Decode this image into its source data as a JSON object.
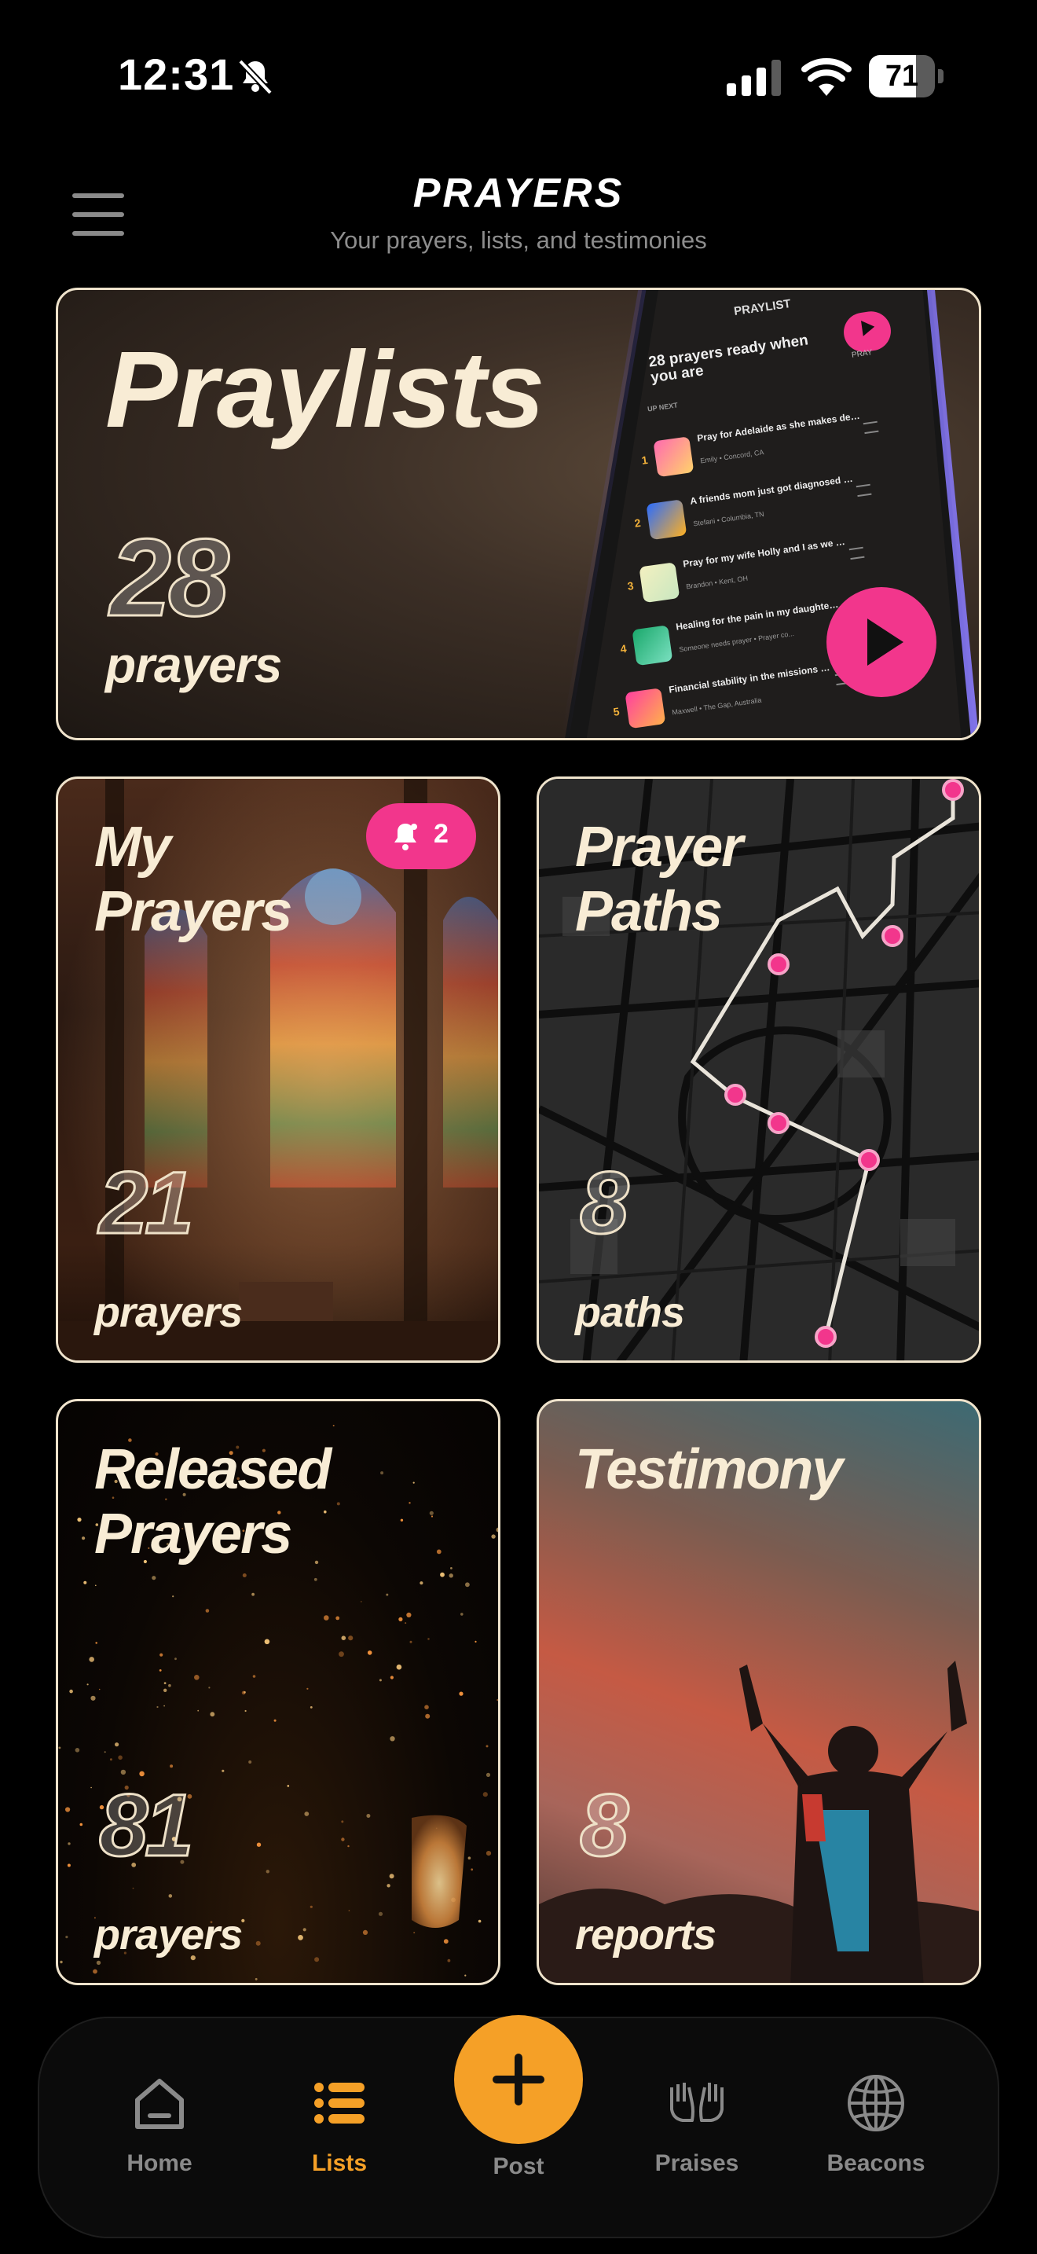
{
  "status_bar": {
    "time": "12:31",
    "battery": 71,
    "battery_text": "71"
  },
  "header": {
    "title": "PRAYERS",
    "subtitle": "Your prayers, lists, and testimonies"
  },
  "cards": {
    "praylists": {
      "title": "Praylists",
      "count": "28",
      "unit": "prayers",
      "phone": {
        "header": "PRAYLIST",
        "pray_label": "PRAY",
        "headline": "28 prayers ready when you are",
        "up_next": "UP NEXT",
        "items": [
          {
            "n": "1",
            "text": "Pray for Adelaide as she makes decisions about her future; col...",
            "sub": "Emily • Concord, CA"
          },
          {
            "n": "2",
            "text": "A friends mom just got diagnosed with late stage lung...",
            "sub": "Stefani • Columbia, TN"
          },
          {
            "n": "3",
            "text": "Pray for my wife Holly and I as we consider being a part of th...",
            "sub": "Brandon • Kent, OH"
          },
          {
            "n": "4",
            "text": "Healing for the pain in my daughter's back",
            "sub": "Someone needs prayer • Prayer co..."
          },
          {
            "n": "5",
            "text": "Financial stability in the missions field",
            "sub": "Maxwell • The Gap, Australia"
          }
        ]
      }
    },
    "my_prayers": {
      "title_line1": "My",
      "title_line2": "Prayers",
      "count": "21",
      "unit": "prayers",
      "badge_count": "2"
    },
    "prayer_paths": {
      "title_line1": "Prayer",
      "title_line2": "Paths",
      "count": "8",
      "unit": "paths"
    },
    "released": {
      "title_line1": "Released",
      "title_line2": "Prayers",
      "count": "81",
      "unit": "prayers"
    },
    "testimony": {
      "title": "Testimony",
      "count": "8",
      "unit": "reports"
    }
  },
  "tabbar": {
    "home": "Home",
    "lists": "Lists",
    "post": "Post",
    "praises": "Praises",
    "beacons": "Beacons",
    "active": "Lists",
    "accent": "#f5a027",
    "inactive_color": "#8a8a8a"
  },
  "colors": {
    "badge": "#f2368c",
    "pink_accent": "#f2368c",
    "card_border": "#efe3cc"
  }
}
